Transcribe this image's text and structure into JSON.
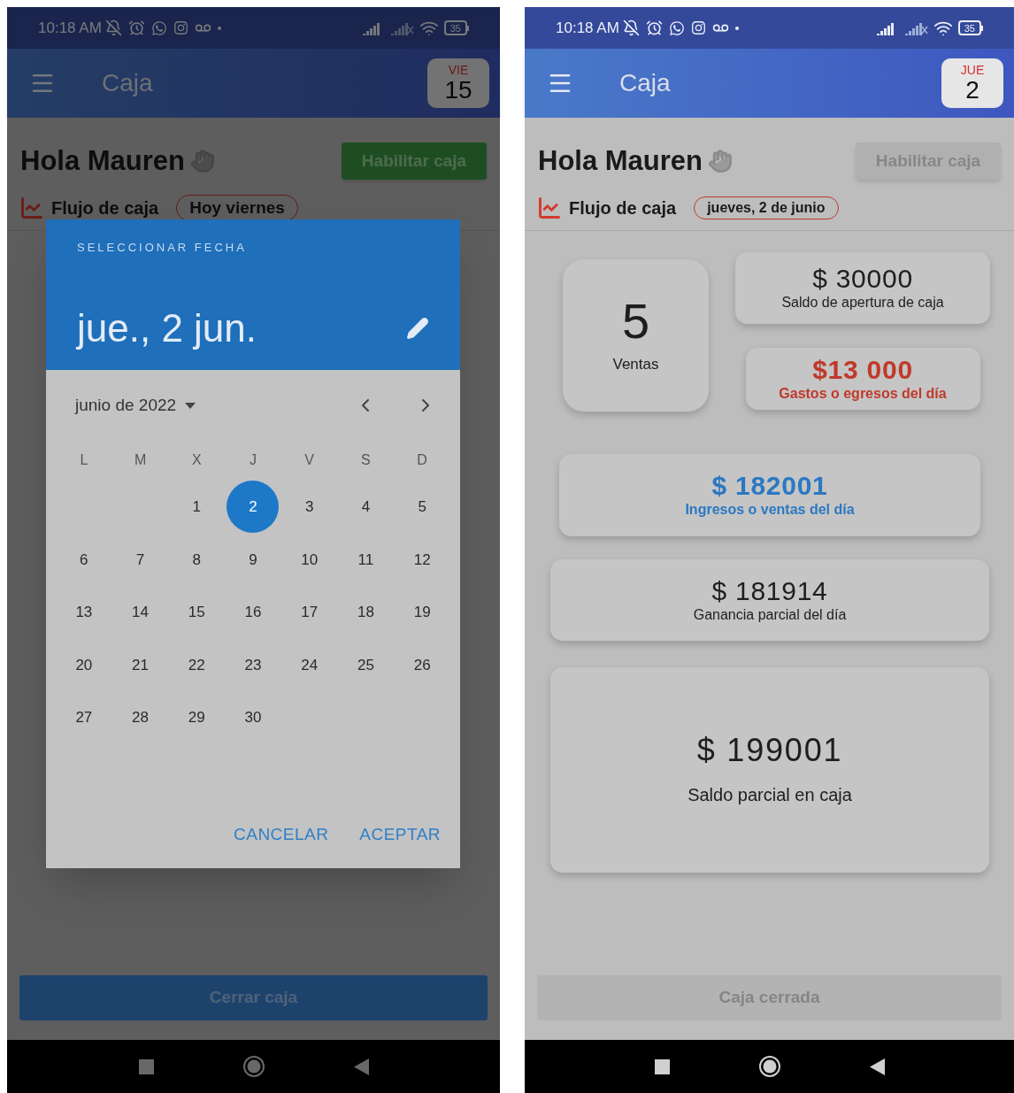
{
  "phones": [
    {
      "status_bar": {
        "time": "10:18 AM",
        "battery": "35"
      },
      "app_bar": {
        "title": "Caja",
        "day_badge": {
          "weekday": "VIE",
          "day": "15"
        }
      },
      "greeting": "Hola Mauren",
      "enable_button": {
        "label": "Habilitar caja",
        "disabled": false
      },
      "section": {
        "title": "Flujo de caja",
        "date_chip": "Hoy viernes"
      },
      "bottom_button": {
        "label": "Cerrar caja",
        "disabled": false
      },
      "date_picker": {
        "heading": "SELECCIONAR FECHA",
        "selected_date": "jue., 2 jun.",
        "month": "junio de 2022",
        "weekdays": [
          "L",
          "M",
          "X",
          "J",
          "V",
          "S",
          "D"
        ],
        "weeks": [
          [
            {
              "label": "1",
              "selected": false
            },
            {
              "label": "2",
              "selected": true
            },
            {
              "label": "3",
              "selected": false
            },
            {
              "label": "4",
              "selected": false
            },
            {
              "label": "5",
              "selected": false
            }
          ],
          [
            {
              "label": "6",
              "selected": false
            },
            {
              "label": "7",
              "selected": false
            },
            {
              "label": "8",
              "selected": false
            },
            {
              "label": "9",
              "selected": false
            },
            {
              "label": "10",
              "selected": false
            },
            {
              "label": "11",
              "selected": false
            },
            {
              "label": "12",
              "selected": false
            }
          ],
          [
            {
              "label": "13",
              "selected": false
            },
            {
              "label": "14",
              "selected": false
            },
            {
              "label": "15",
              "selected": false
            },
            {
              "label": "16",
              "selected": false
            },
            {
              "label": "17",
              "selected": false
            },
            {
              "label": "18",
              "selected": false
            },
            {
              "label": "19",
              "selected": false
            }
          ],
          [
            {
              "label": "20",
              "selected": false
            },
            {
              "label": "21",
              "selected": false
            },
            {
              "label": "22",
              "selected": false
            },
            {
              "label": "23",
              "selected": false
            },
            {
              "label": "24",
              "selected": false
            },
            {
              "label": "25",
              "selected": false
            },
            {
              "label": "26",
              "selected": false
            }
          ],
          [
            {
              "label": "27",
              "selected": false
            },
            {
              "label": "28",
              "selected": false
            },
            {
              "label": "29",
              "selected": false
            },
            {
              "label": "30",
              "selected": false
            }
          ]
        ],
        "buttons": [
          "CANCELAR",
          "ACEPTAR"
        ]
      }
    },
    {
      "status_bar": {
        "time": "10:18 AM",
        "battery": "35"
      },
      "app_bar": {
        "title": "Caja",
        "day_badge": {
          "weekday": "JUE",
          "day": "2"
        }
      },
      "greeting": "Hola Mauren",
      "enable_button": {
        "label": "Habilitar caja",
        "disabled": true
      },
      "section": {
        "title": "Flujo de caja",
        "date_chip": "jueves, 2 de junio"
      },
      "stats": [
        {
          "kind": "count",
          "color": "#1e1e1e",
          "value": "5",
          "label": "Ventas"
        },
        {
          "kind": "amount",
          "color": "#1e1e1e",
          "value": "$ 30000",
          "label": "Saldo de apertura de caja"
        },
        {
          "kind": "highlight",
          "color": "#c0392b",
          "value": "$13 000",
          "label": "Gastos o egresos del día"
        },
        {
          "kind": "highlight",
          "color": "#2b78c2",
          "value": "$ 182001",
          "label": "Ingresos o ventas del día"
        },
        {
          "kind": "amount",
          "color": "#1e1e1e",
          "value": "$ 181914",
          "label": "Ganancia parcial del día"
        },
        {
          "kind": "total",
          "color": "#1e1e1e",
          "value": "$ 199001",
          "label": "Saldo parcial en caja"
        }
      ],
      "bottom_button": {
        "label": "Caja cerrada",
        "disabled": true
      }
    }
  ]
}
